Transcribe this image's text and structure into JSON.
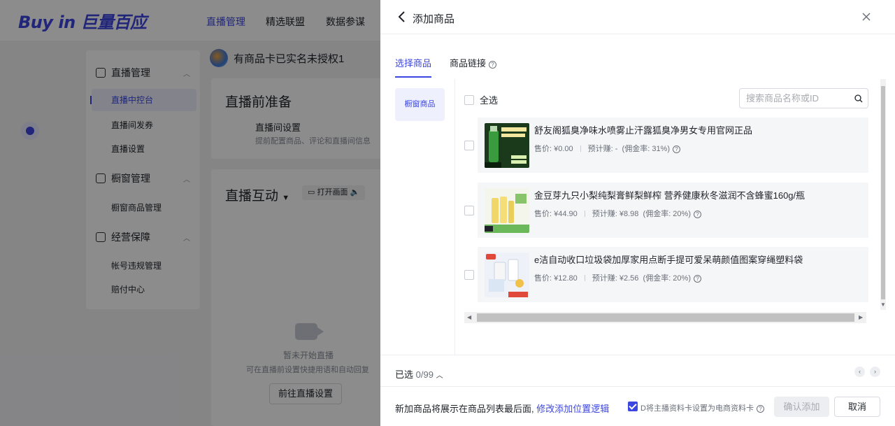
{
  "app": {
    "logo": "Buy in 巨量百应",
    "nav": [
      "直播管理",
      "精选联盟",
      "数据参谋"
    ]
  },
  "sidebar": {
    "groups": [
      {
        "label": "直播管理",
        "items": [
          "直播中控台",
          "直播间发券",
          "直播设置"
        ]
      },
      {
        "label": "橱窗管理",
        "items": [
          "橱窗商品管理"
        ]
      },
      {
        "label": "经营保障",
        "items": [
          "帐号违规管理",
          "赔付中心"
        ]
      }
    ]
  },
  "main": {
    "store_title": "有商品卡已实名未授权1",
    "prep": {
      "title": "直播前准备",
      "item_title": "直播间设置",
      "item_desc": "提前配置商品、评论和直播间信息"
    },
    "interact": {
      "title": "直播互动",
      "open_btn": "打开画面",
      "empty_title": "暂未开始直播",
      "empty_desc": "可在直播前设置快捷用语和自动回复",
      "goto_btn": "前往直播设置"
    }
  },
  "drawer": {
    "title": "添加商品",
    "tabs": [
      "选择商品",
      "商品链接"
    ],
    "left_nav": "橱窗商品",
    "select_all": "全选",
    "search_placeholder": "搜索商品名称或ID",
    "products": [
      {
        "name": "舒友阁狐臭净味水喷雾止汗露狐臭净男女专用官网正品",
        "price": "售价: ¥0.00",
        "earn": "预计赚: -",
        "rate": "(佣金率: 31%)"
      },
      {
        "name": "金豆芽九只小梨纯梨膏鲜梨鲜榨 营养健康秋冬滋润不含蜂蜜160g/瓶",
        "price": "售价: ¥44.90",
        "earn": "预计赚: ¥8.98",
        "rate": "(佣金率: 20%)"
      },
      {
        "name": "e洁自动收口垃圾袋加厚家用点断手提可爱呆萌颜值图案穿绳塑料袋",
        "price": "售价: ¥12.80",
        "earn": "预计赚: ¥2.56",
        "rate": "(佣金率: 20%)"
      }
    ],
    "selected_label": "已选",
    "selected_count": "0/99",
    "footer_note": "新加商品将展示在商品列表最后面,",
    "footer_link": "修改添加位置逻辑",
    "checkbox_label": "D将主播资料卡设置为电商资料卡",
    "confirm": "确认添加",
    "cancel": "取消"
  },
  "colors": {
    "accent": "#3c46e0"
  }
}
